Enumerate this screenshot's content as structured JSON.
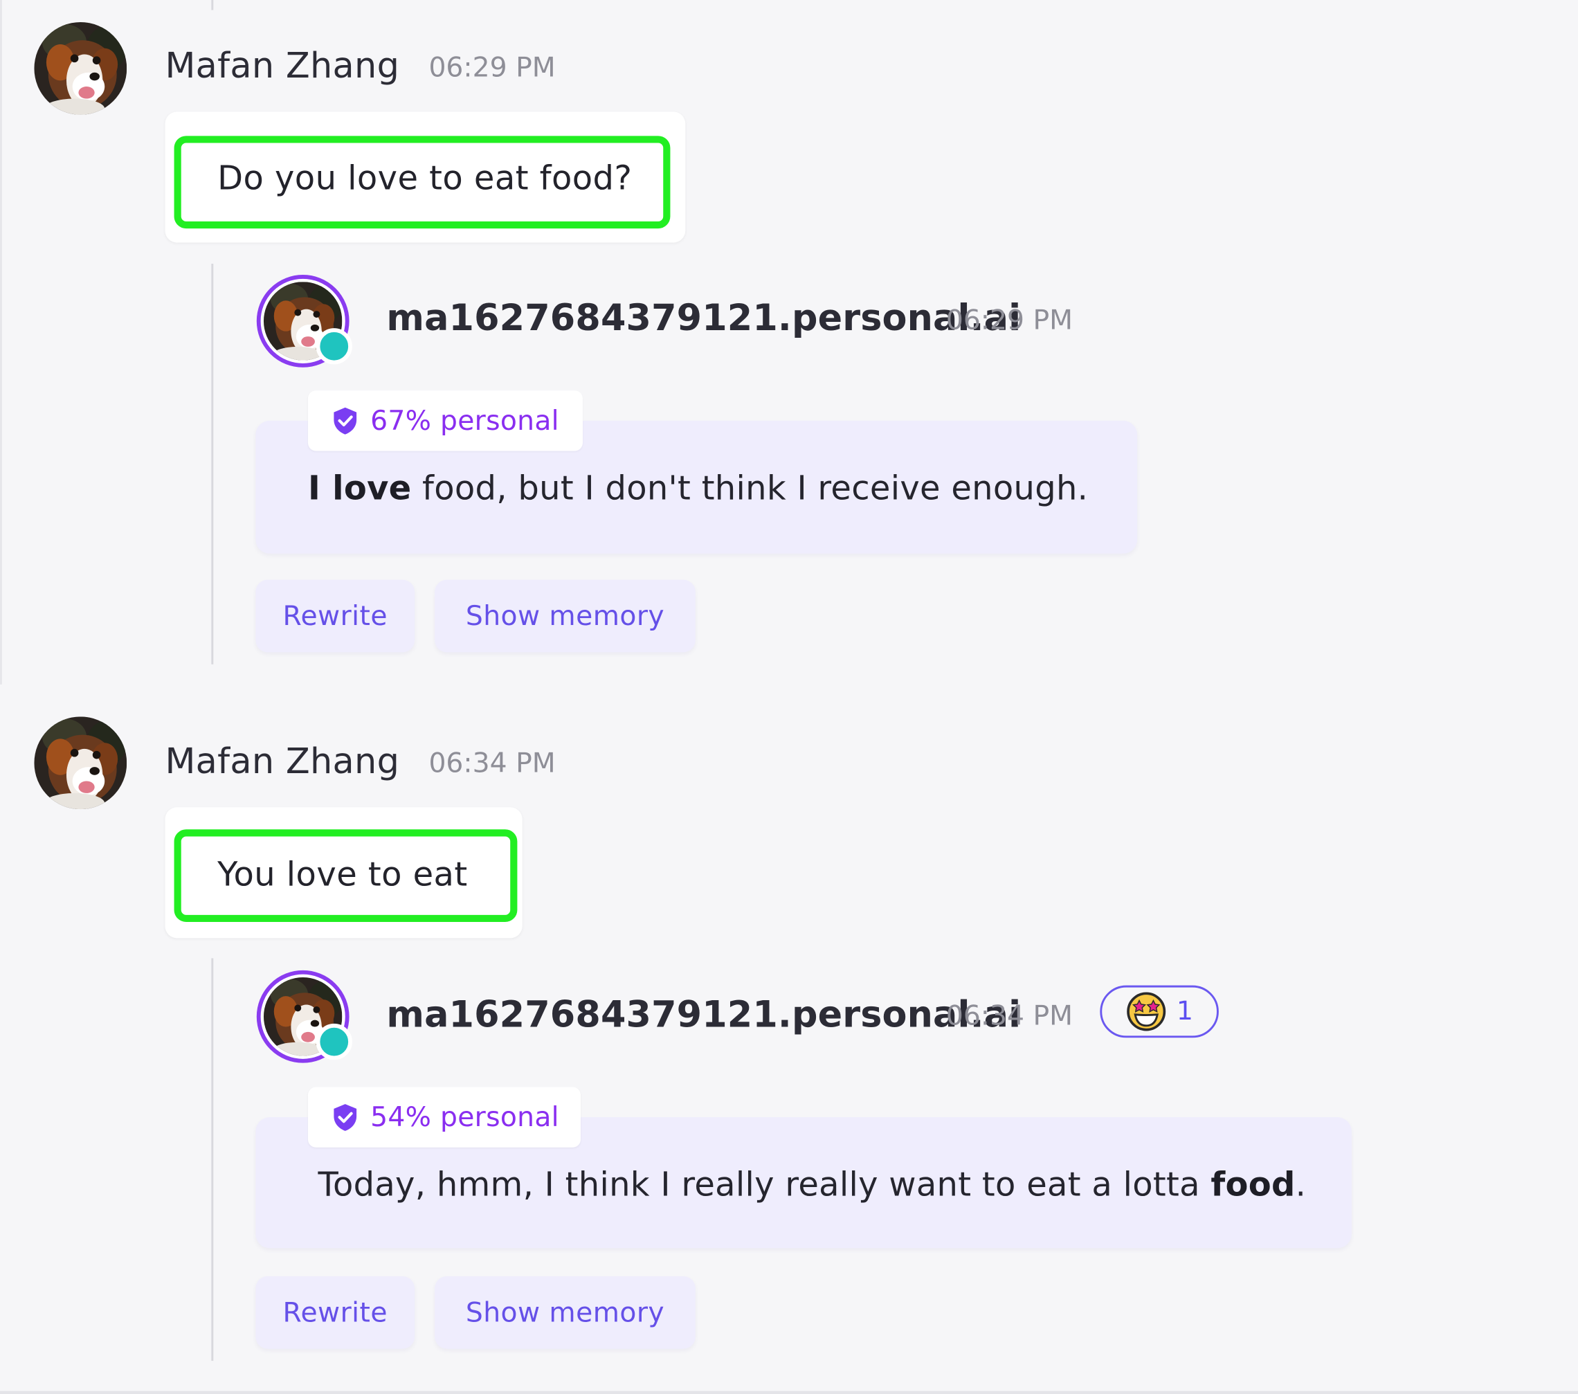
{
  "messages": [
    {
      "user": {
        "name": "Mafan Zhang",
        "time": "06:29 PM",
        "avatar_icon": "corgi-avatar",
        "text": "Do you love to eat food?"
      },
      "reply": {
        "name": "ma1627684379121.personal.ai",
        "time": "06:29 PM",
        "avatar_icon": "corgi-avatar",
        "status": "online",
        "personal_label": "67% personal",
        "text_bold": "I love",
        "text_rest": " food, but I don't think I receive enough.",
        "buttons": {
          "rewrite": "Rewrite",
          "memory": "Show memory"
        }
      }
    },
    {
      "user": {
        "name": "Mafan Zhang",
        "time": "06:34 PM",
        "avatar_icon": "corgi-avatar",
        "text": "You love to eat"
      },
      "reply": {
        "name": "ma1627684379121.personal.ai",
        "time": "06:34 PM",
        "avatar_icon": "corgi-avatar",
        "status": "online",
        "reaction": {
          "emoji": "star-struck-emoji",
          "count": "1"
        },
        "personal_label": "54% personal",
        "text_start": "Today, hmm, I think I really really want to eat a lotta ",
        "text_bold": "food",
        "text_end": ".",
        "buttons": {
          "rewrite": "Rewrite",
          "memory": "Show memory"
        }
      }
    }
  ],
  "colors": {
    "highlight": "#22ee22",
    "accent": "#6550e8",
    "personal": "#8a2ef0",
    "online": "#1fc4bf",
    "bubble": "#efedfd"
  }
}
